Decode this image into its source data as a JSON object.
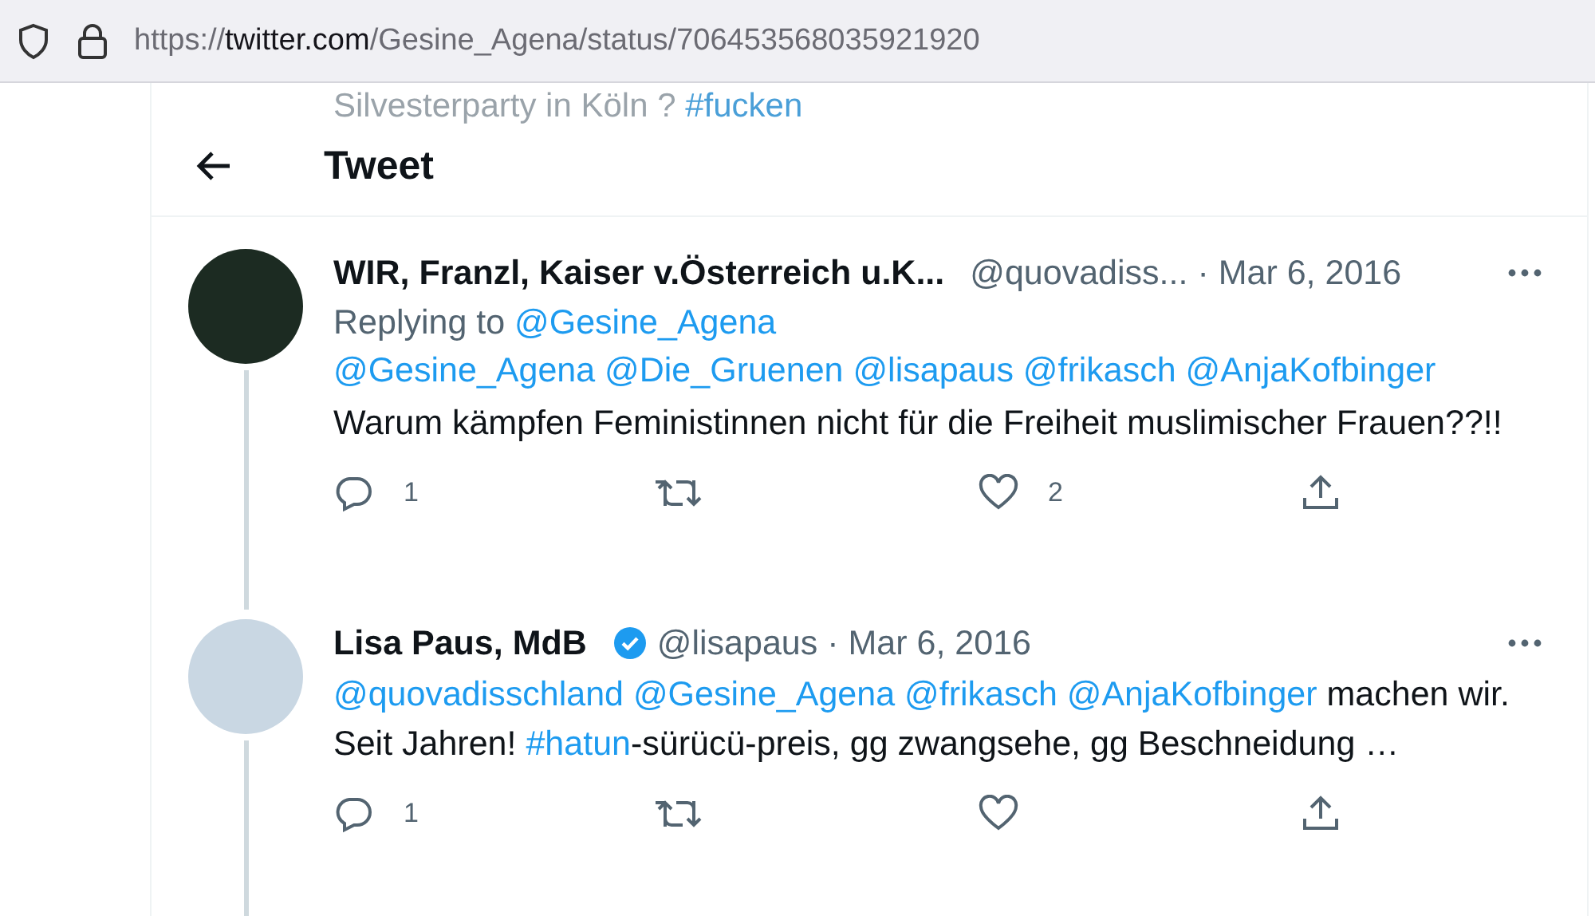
{
  "address_bar": {
    "scheme": "https://",
    "domain": "twitter.com",
    "path": "/Gesine_Agena/status/706453568035921920"
  },
  "behind_header": {
    "segments": [
      {
        "text": "Silvesterparty in Köln ? ",
        "link": false
      },
      {
        "text": "#fucken",
        "link": true
      }
    ]
  },
  "header": {
    "title": "Tweet"
  },
  "tweets": [
    {
      "name": "WIR, Franzl, Kaiser v.Österreich u.K...",
      "verified": false,
      "handle": "@quovadiss...",
      "date": "· Mar 6, 2016",
      "replying_to": {
        "label": "Replying to ",
        "handle": "@Gesine_Agena"
      },
      "lines": [
        [
          {
            "text": "@Gesine_Agena @Die_Gruenen @lisapaus @frikasch @AnjaKofbinger",
            "link": true
          }
        ],
        [
          {
            "text": "Warum kämpfen Feministinnen nicht für die Freiheit muslimischer Frauen??!!",
            "link": false
          }
        ]
      ],
      "replies": "1",
      "likes": "2",
      "thread_line": true
    },
    {
      "name": "Lisa Paus, MdB",
      "verified": true,
      "handle": "@lisapaus",
      "date": "· Mar 6, 2016",
      "lines": [
        [
          {
            "text": "@quovadisschland @Gesine_Agena @frikasch @AnjaKofbinger",
            "link": true
          },
          {
            "text": " machen wir. Seit Jahren! ",
            "link": false
          },
          {
            "text": "#hatun",
            "link": true
          },
          {
            "text": "-sürücü-preis, gg zwangsehe, gg Beschneidung …",
            "link": false
          }
        ]
      ],
      "replies": "1",
      "thread_line": true
    }
  ]
}
